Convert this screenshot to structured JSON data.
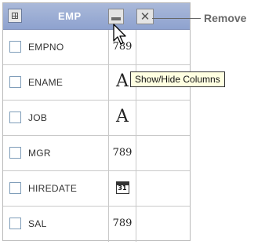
{
  "header": {
    "title": "EMP",
    "table_icon": "table-grid-icon",
    "minimize_icon": "minimize-icon",
    "close_symbol": "✕"
  },
  "callout": {
    "remove_label": "Remove"
  },
  "tooltip": {
    "text": "Show/Hide Columns"
  },
  "columns": [
    {
      "name": "EMPNO",
      "type": "number",
      "type_glyph": "789",
      "checked": false
    },
    {
      "name": "ENAME",
      "type": "string",
      "type_glyph": "A",
      "checked": false
    },
    {
      "name": "JOB",
      "type": "string",
      "type_glyph": "A",
      "checked": false
    },
    {
      "name": "MGR",
      "type": "number",
      "type_glyph": "789",
      "checked": false
    },
    {
      "name": "HIREDATE",
      "type": "date",
      "type_glyph": "31",
      "checked": false
    },
    {
      "name": "SAL",
      "type": "number",
      "type_glyph": "789",
      "checked": false
    }
  ],
  "colors": {
    "header_top": "#aab9d9",
    "header_bottom": "#8ea2cf",
    "tooltip_bg": "#ffffe1",
    "checkbox_border": "#7f9db9"
  }
}
